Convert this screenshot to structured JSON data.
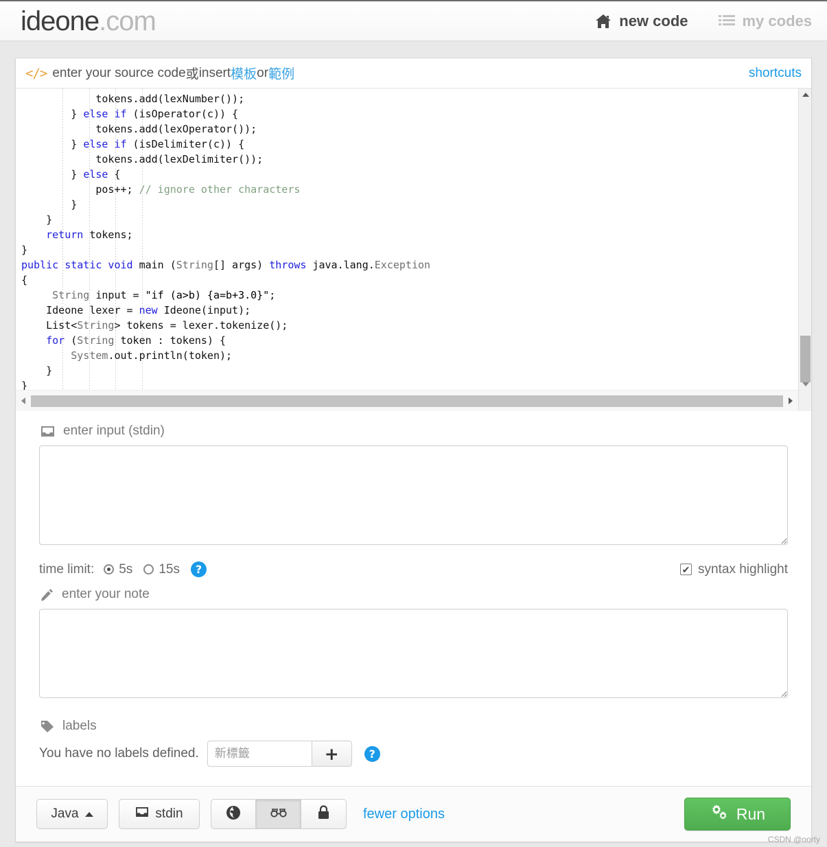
{
  "header": {
    "logo_main": "ideone",
    "logo_suffix": ".com",
    "nav": [
      {
        "label": "new code",
        "icon": "home-icon",
        "state": "active"
      },
      {
        "label": "my codes",
        "icon": "list-icon",
        "state": "inactive"
      }
    ]
  },
  "source": {
    "icon": "code-tags-icon",
    "label_prefix": "enter your source code ",
    "label_or_cn": "或",
    "label_insert": " insert ",
    "link_template": "模板",
    "label_or": " or ",
    "link_example": "範例",
    "shortcuts_label": "shortcuts",
    "scrollbar": {
      "vertical_up": "scroll-up-arrow",
      "vertical_down": "scroll-down-arrow",
      "horizontal_left": "scroll-left-arrow",
      "horizontal_right": "scroll-right-arrow"
    },
    "code_lines": [
      [
        {
          "t": "            tokens.add(lexNumber());",
          "c": ""
        }
      ],
      [
        {
          "t": "        } ",
          "c": ""
        },
        {
          "t": "else if",
          "c": "kw"
        },
        {
          "t": " (isOperator(c)) {",
          "c": ""
        }
      ],
      [
        {
          "t": "            tokens.add(lexOperator());",
          "c": ""
        }
      ],
      [
        {
          "t": "        } ",
          "c": ""
        },
        {
          "t": "else if",
          "c": "kw"
        },
        {
          "t": " (isDelimiter(c)) {",
          "c": ""
        }
      ],
      [
        {
          "t": "            tokens.add(lexDelimiter());",
          "c": ""
        }
      ],
      [
        {
          "t": "        } ",
          "c": ""
        },
        {
          "t": "else",
          "c": "kw"
        },
        {
          "t": " {",
          "c": ""
        }
      ],
      [
        {
          "t": "            pos++; ",
          "c": ""
        },
        {
          "t": "// ignore other characters",
          "c": "cm"
        }
      ],
      [
        {
          "t": "        }",
          "c": ""
        }
      ],
      [
        {
          "t": "    }",
          "c": ""
        }
      ],
      [
        {
          "t": "    ",
          "c": ""
        },
        {
          "t": "return",
          "c": "kw"
        },
        {
          "t": " tokens;",
          "c": ""
        }
      ],
      [
        {
          "t": "}",
          "c": ""
        }
      ],
      [
        {
          "t": "public static void",
          "c": "kw"
        },
        {
          "t": " main (",
          "c": ""
        },
        {
          "t": "String",
          "c": "ty"
        },
        {
          "t": "[] args) ",
          "c": ""
        },
        {
          "t": "throws",
          "c": "kw"
        },
        {
          "t": " java.lang.",
          "c": ""
        },
        {
          "t": "Exception",
          "c": "ty"
        }
      ],
      [
        {
          "t": "{",
          "c": ""
        }
      ],
      [
        {
          "t": "     ",
          "c": ""
        },
        {
          "t": "String",
          "c": "ty"
        },
        {
          "t": " input = ",
          "c": ""
        },
        {
          "t": "\"if (a>b) {a=b+3.0}\"",
          "c": "st"
        },
        {
          "t": ";",
          "c": ""
        }
      ],
      [
        {
          "t": "    Ideone lexer = ",
          "c": ""
        },
        {
          "t": "new",
          "c": "kw"
        },
        {
          "t": " Ideone(input);",
          "c": ""
        }
      ],
      [
        {
          "t": "    List<",
          "c": ""
        },
        {
          "t": "String",
          "c": "ty"
        },
        {
          "t": "> tokens = lexer.tokenize();",
          "c": ""
        }
      ],
      [
        {
          "t": "    ",
          "c": ""
        },
        {
          "t": "for",
          "c": "kw"
        },
        {
          "t": " (",
          "c": ""
        },
        {
          "t": "String",
          "c": "ty"
        },
        {
          "t": " token : tokens) {",
          "c": ""
        }
      ],
      [
        {
          "t": "        ",
          "c": ""
        },
        {
          "t": "System",
          "c": "ty"
        },
        {
          "t": ".out.println(token);",
          "c": ""
        }
      ],
      [
        {
          "t": "    }",
          "c": ""
        }
      ],
      [
        {
          "t": "}",
          "c": ""
        }
      ],
      [
        {
          "t": "}",
          "c": ""
        }
      ]
    ]
  },
  "stdin": {
    "icon": "inbox-icon",
    "label": "enter input (stdin)",
    "value": "",
    "placeholder": ""
  },
  "options": {
    "time_limit_label": "time limit:",
    "time_limit_options": [
      {
        "label": "5s",
        "selected": true
      },
      {
        "label": "15s",
        "selected": false
      }
    ],
    "help_icon": "question-mark-icon",
    "help_glyph": "?",
    "syntax_highlight_label": "syntax highlight",
    "syntax_highlight_checked": true,
    "check_glyph": "✔"
  },
  "note": {
    "icon": "pencil-icon",
    "label": "enter your note",
    "value": "",
    "placeholder": ""
  },
  "labels": {
    "icon": "tag-icon",
    "label": "labels",
    "empty_text": "You have no labels defined.",
    "input_placeholder": "新標籤",
    "input_value": "",
    "add_glyph": "+",
    "help_glyph": "?"
  },
  "footer": {
    "language": "Java",
    "language_caret": "caret-up-icon",
    "stdin_button": "stdin",
    "visibility": [
      {
        "name": "public",
        "icon": "globe-icon",
        "selected": false
      },
      {
        "name": "secret",
        "icon": "glasses-icon",
        "selected": true
      },
      {
        "name": "private",
        "icon": "lock-icon",
        "selected": false
      }
    ],
    "fewer_options": "fewer options",
    "run_label": "Run",
    "run_icon": "cogs-icon",
    "run_color": "#56bc56"
  },
  "watermark": "CSDN @oorty"
}
